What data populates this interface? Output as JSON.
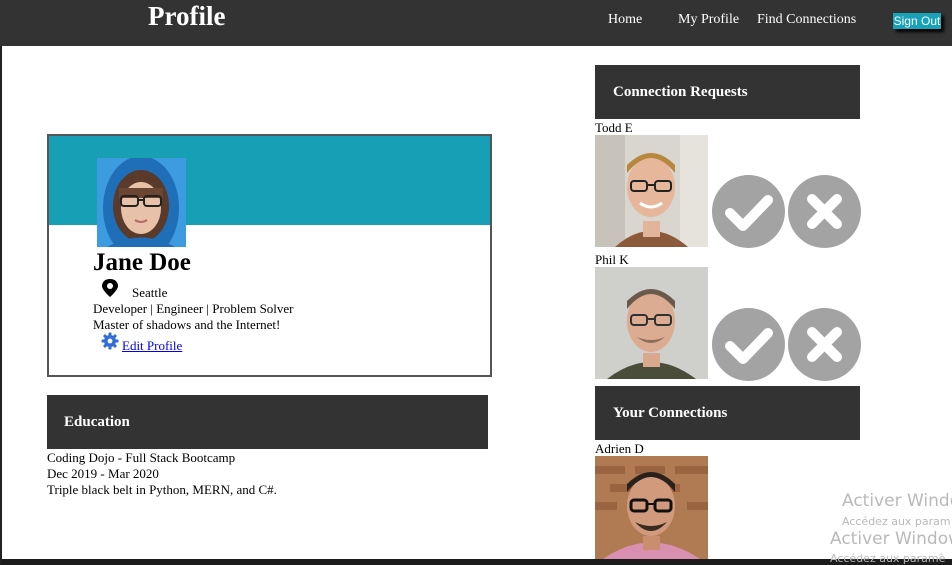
{
  "nav": {
    "title": "Profile",
    "links": [
      {
        "label": "Home"
      },
      {
        "label": "My Profile"
      },
      {
        "label": "Find Connections"
      }
    ],
    "sign_out": "Sign Out"
  },
  "profile": {
    "name": "Jane Doe",
    "location": "Seattle",
    "headline": "Developer | Engineer | Problem Solver",
    "bio": "Master of shadows and the Internet!",
    "edit_label": "Edit Profile",
    "banner_color": "#17a0b5"
  },
  "education": {
    "header": "Education",
    "school": "Coding Dojo - Full Stack Bootcamp",
    "dates": "Dec 2019 - Mar 2020",
    "description": "Triple black belt in Python, MERN, and C#."
  },
  "connection_requests": {
    "header": "Connection Requests",
    "items": [
      {
        "name": "Todd E"
      },
      {
        "name": "Phil K"
      }
    ]
  },
  "connections": {
    "header": "Your Connections",
    "items": [
      {
        "name": "Adrien D"
      }
    ]
  },
  "watermark": {
    "line1": "Activer Windo",
    "line2": "Accédez aux param",
    "line3": "Activer Window",
    "line4": "Accédez aux paramè"
  },
  "colors": {
    "nav_bg": "#333333",
    "accent": "#17a2b8",
    "action_gray": "#a3a3a3"
  }
}
